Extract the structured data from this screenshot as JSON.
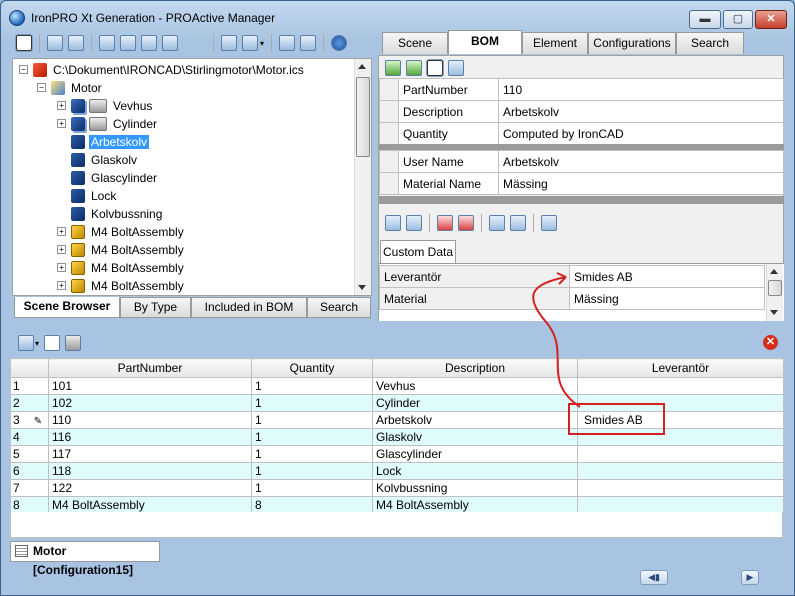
{
  "window": {
    "title": "IronPRO  Xt Generation  - PROActive Manager",
    "minimize": "▬",
    "maximize": "▢",
    "close": "✕"
  },
  "tree": {
    "root_path": "C:\\Dokument\\IRONCAD\\Stirlingmotor\\Motor.ics",
    "items": [
      {
        "label": "Motor"
      },
      {
        "label": "Vevhus"
      },
      {
        "label": "Cylinder"
      },
      {
        "label": "Arbetskolv"
      },
      {
        "label": "Glaskolv"
      },
      {
        "label": "Glascylinder"
      },
      {
        "label": "Lock"
      },
      {
        "label": "Kolvbussning"
      },
      {
        "label": "M4 BoltAssembly"
      },
      {
        "label": "M4 BoltAssembly"
      },
      {
        "label": "M4 BoltAssembly"
      },
      {
        "label": "M4 BoltAssembly"
      }
    ]
  },
  "browser_tabs": [
    "Scene Browser",
    "By Type",
    "Included in BOM",
    "Search"
  ],
  "top_tabs": [
    "Scene",
    "BOM",
    "Element",
    "Configurations",
    "Search"
  ],
  "props": [
    {
      "name": "PartNumber",
      "value": "110"
    },
    {
      "name": "Description",
      "value": "Arbetskolv"
    },
    {
      "name": "Quantity",
      "value": "Computed by IronCAD"
    }
  ],
  "props2": [
    {
      "name": "User Name",
      "value": "Arbetskolv"
    },
    {
      "name": "Material Name",
      "value": "Mässing"
    }
  ],
  "custom_tab": "Custom Data",
  "custom": [
    {
      "name": "Leverantör",
      "value": "Smides AB"
    },
    {
      "name": "Material",
      "value": "Mässing"
    }
  ],
  "bom": {
    "headers": [
      "PartNumber",
      "Quantity",
      "Description",
      "Leverantör"
    ],
    "rows": [
      {
        "n": "1",
        "part": "101",
        "qty": "1",
        "desc": "Vevhus",
        "lev": ""
      },
      {
        "n": "2",
        "part": "102",
        "qty": "1",
        "desc": "Cylinder",
        "lev": ""
      },
      {
        "n": "3",
        "part": "110",
        "qty": "1",
        "desc": "Arbetskolv",
        "lev": "Smides AB"
      },
      {
        "n": "4",
        "part": "116",
        "qty": "1",
        "desc": "Glaskolv",
        "lev": ""
      },
      {
        "n": "5",
        "part": "117",
        "qty": "1",
        "desc": "Glascylinder",
        "lev": ""
      },
      {
        "n": "6",
        "part": "118",
        "qty": "1",
        "desc": "Lock",
        "lev": ""
      },
      {
        "n": "7",
        "part": "122",
        "qty": "1",
        "desc": "Kolvbussning",
        "lev": ""
      },
      {
        "n": "8",
        "part": "M4 BoltAssembly",
        "qty": "8",
        "desc": "M4 BoltAssembly",
        "lev": ""
      }
    ]
  },
  "doc_tab": "Motor [Configuration15]",
  "colors": {
    "highlight": "#d42020",
    "selection": "#3399ff",
    "row_alt": "#e0fbfb"
  }
}
